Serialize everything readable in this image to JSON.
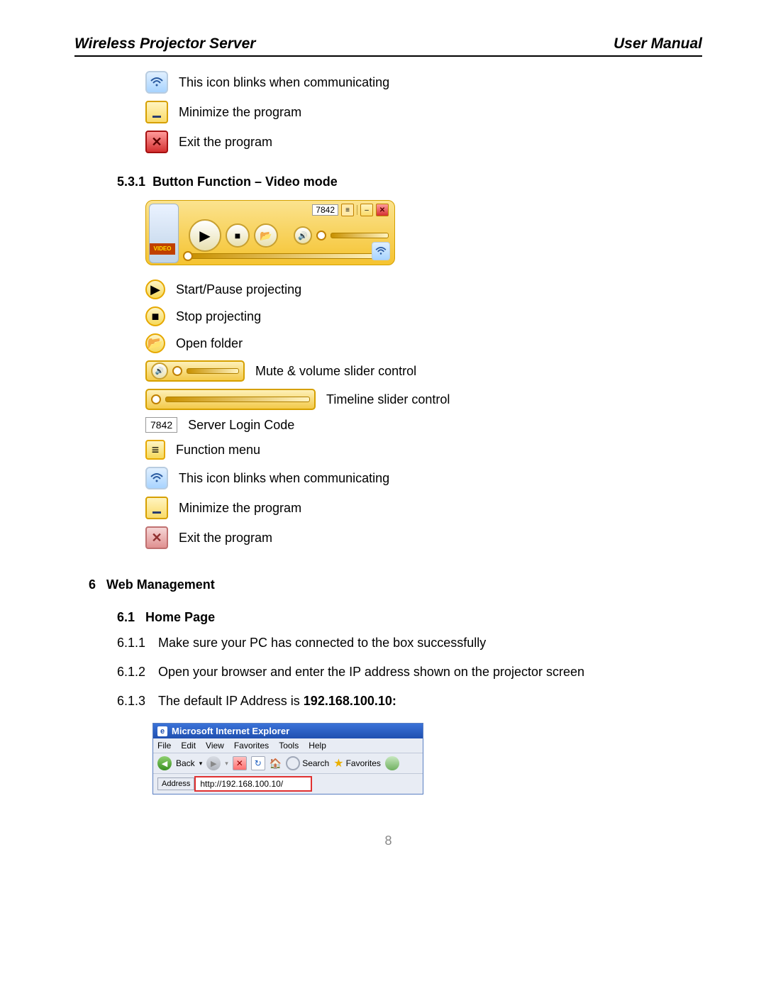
{
  "header": {
    "left": "Wireless Projector Server",
    "right": "User Manual"
  },
  "topIcons": [
    {
      "name": "wifi-blink-icon",
      "label": "This icon blinks when communicating"
    },
    {
      "name": "minimize-icon",
      "label": "Minimize the program"
    },
    {
      "name": "exit-icon",
      "label": "Exit the program"
    }
  ],
  "section531": {
    "number": "5.3.1",
    "title": "Button Function – Video mode"
  },
  "videoPanel": {
    "code": "7842",
    "videoTab": "VIDEO"
  },
  "videoIcons": [
    {
      "name": "play-icon",
      "label": "Start/Pause projecting"
    },
    {
      "name": "stop-icon",
      "label": "Stop projecting"
    },
    {
      "name": "open-folder-icon",
      "label": "Open folder"
    },
    {
      "name": "mute-volume-slider",
      "label": "Mute & volume slider control",
      "wide": true
    },
    {
      "name": "timeline-slider",
      "label": "Timeline slider control",
      "wide": true,
      "long": true
    },
    {
      "name": "server-login-code",
      "label": "Server Login Code",
      "code": "7842"
    },
    {
      "name": "function-menu-icon",
      "label": "Function menu"
    },
    {
      "name": "wifi-blink-icon",
      "label": "This icon blinks when communicating"
    },
    {
      "name": "minimize-icon",
      "label": "Minimize the program"
    },
    {
      "name": "exit-icon",
      "label": "Exit the program"
    }
  ],
  "section6": {
    "number": "6",
    "title": "Web Management"
  },
  "section61": {
    "number": "6.1",
    "title": "Home Page"
  },
  "steps": [
    {
      "num": "6.1.1",
      "text": "Make sure your PC has connected to the box successfully"
    },
    {
      "num": "6.1.2",
      "text": "Open your browser and enter the IP address shown on the projector screen"
    },
    {
      "num": "6.1.3",
      "text_prefix": "The default IP Address is ",
      "text_bold": "192.168.100.10:"
    }
  ],
  "ie": {
    "title": "Microsoft Internet Explorer",
    "menu": [
      "File",
      "Edit",
      "View",
      "Favorites",
      "Tools",
      "Help"
    ],
    "back": "Back",
    "search": "Search",
    "favorites": "Favorites",
    "addr_label": "Address",
    "url": "http://192.168.100.10/"
  },
  "pageNumber": "8"
}
